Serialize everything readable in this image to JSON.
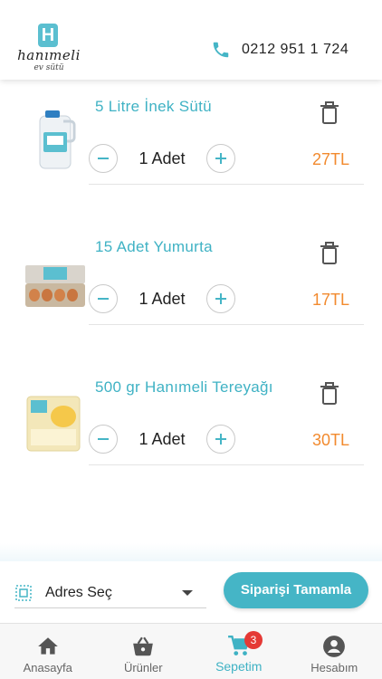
{
  "header": {
    "logo_mark": "H",
    "logo_brand": "hanımeli",
    "logo_sub": "ev sütü",
    "phone_icon": "phone-icon",
    "phone": "0212 951 1 724"
  },
  "cart": {
    "items": [
      {
        "name": "5 Litre İnek Sütü",
        "quantity": "1 Adet",
        "price": "27TL"
      },
      {
        "name": "15 Adet Yumurta",
        "quantity": "1 Adet",
        "price": "17TL"
      },
      {
        "name": "500 gr Hanımeli Tereyağı",
        "quantity": "1 Adet",
        "price": "30TL"
      }
    ]
  },
  "checkout": {
    "address_label": "Adres Seç",
    "complete_label": "Siparişi Tamamla"
  },
  "tabbar": {
    "tabs": [
      {
        "label": "Anasayfa",
        "icon": "home-icon"
      },
      {
        "label": "Ürünler",
        "icon": "basket-icon"
      },
      {
        "label": "Sepetim",
        "icon": "cart-icon",
        "badge": "3",
        "active": true
      },
      {
        "label": "Hesabım",
        "icon": "account-icon"
      }
    ]
  },
  "colors": {
    "accent": "#45b5c6",
    "price": "#f28a2e",
    "badge": "#e53935"
  }
}
